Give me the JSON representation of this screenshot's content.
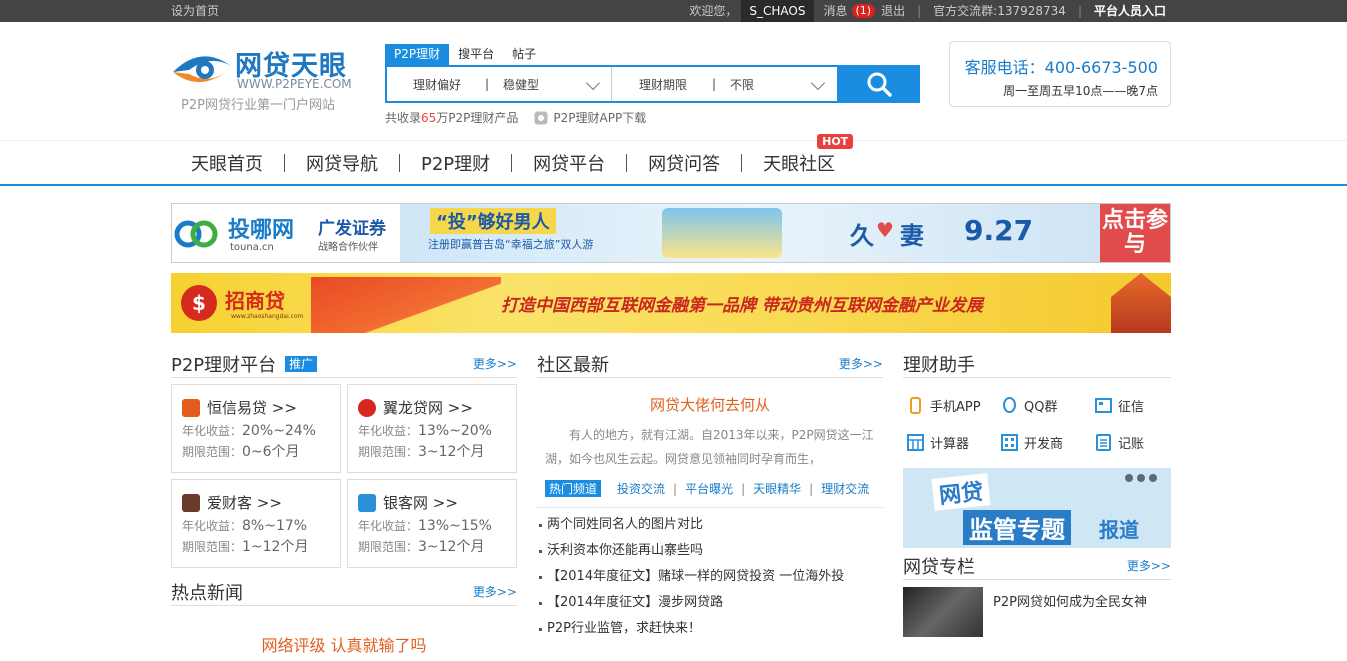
{
  "topbar": {
    "set_home": "设为首页",
    "welcome": "欢迎您，",
    "username": "S_CHAOS",
    "messages": "消息",
    "msg_count": "(1)",
    "logout": "退出",
    "qq_group": "官方交流群:137928734",
    "platform_entry": "平台人员入口"
  },
  "logo": {
    "name": "网贷天眼",
    "url": "WWW.P2PEYE.COM",
    "slogan": "P2P网贷行业第一门户网站"
  },
  "search": {
    "tabs": [
      "P2P理财",
      "搜平台",
      "帖子"
    ],
    "pref_label": "理财偏好",
    "pref_value": "稳健型",
    "term_label": "理财期限",
    "term_value": "不限",
    "sub_prefix": "共收录",
    "sub_count": "65",
    "sub_suffix": "万P2P理财产品",
    "app_label": "P2P理财APP下载"
  },
  "hotline": {
    "phone": "客服电话：400-6673-500",
    "hours": "周一至周五早10点——晚7点"
  },
  "nav": {
    "items": [
      "天眼首页",
      "网贷导航",
      "P2P理财",
      "网贷平台",
      "网贷问答",
      "天眼社区"
    ],
    "hot": "HOT"
  },
  "banner1": {
    "brand": "投哪网",
    "brand_url": "touna.cn",
    "partner": "广发证券",
    "partner_sub": "战略合作伙伴",
    "headline": "“投”够好男人",
    "subline": "注册即赢普吉岛“幸福之旅”双人游",
    "jiu": "久",
    "qi": "妻",
    "date": "9.27",
    "cta": "点击参与"
  },
  "banner2": {
    "brand": "招商贷",
    "brand_url": "www.zhaoshangdai.com",
    "slogan": "打造中国西部互联网金融第一品牌  带动贵州互联网金融产业发展"
  },
  "p2p_platforms": {
    "title": "P2P理财平台",
    "tag": "推广",
    "more": "更多>>",
    "rate_label": "年化收益：",
    "term_label": "期限范围：",
    "items": [
      {
        "name": "恒信易贷 >>",
        "rate": "20%~24%",
        "term": "0~6个月",
        "color": "#e55a1e"
      },
      {
        "name": "翼龙贷网 >>",
        "rate": "13%~20%",
        "term": "3~12个月",
        "color": "#d6261e"
      },
      {
        "name": "爱财客 >>",
        "rate": "8%~17%",
        "term": "1~12个月",
        "color": "#6a3b2a"
      },
      {
        "name": "银客网 >>",
        "rate": "13%~15%",
        "term": "3~12个月",
        "color": "#2a90d8"
      }
    ]
  },
  "hot_news": {
    "title": "热点新闻",
    "more": "更多>>",
    "headline": "网络评级 认真就输了吗"
  },
  "community": {
    "title": "社区最新",
    "more": "更多>>",
    "featured_title": "网贷大佬何去何从",
    "featured_desc": "有人的地方，就有江湖。自2013年以来，P2P网贷这一江湖，如今也风生云起。网贷意见领袖同时孕育而生，",
    "channels": [
      "热门频道",
      "投资交流",
      "平台曝光",
      "天眼精华",
      "理财交流"
    ],
    "posts": [
      "两个同姓同名人的图片对比",
      "沃利资本你还能再山寨些吗",
      "【2014年度征文】赌球一样的网贷投资 一位海外投",
      "【2014年度征文】漫步网贷路",
      "P2P行业监管，求赶快来！"
    ]
  },
  "helper": {
    "title": "理财助手",
    "items": [
      {
        "label": "手机APP",
        "icon": "phone-icon",
        "color": "#f39b1e"
      },
      {
        "label": "QQ群",
        "icon": "qq-icon",
        "color": "#2a90d8"
      },
      {
        "label": "征信",
        "icon": "credit-icon",
        "color": "#2a90d8"
      },
      {
        "label": "计算器",
        "icon": "calculator-icon",
        "color": "#2a90d8"
      },
      {
        "label": "开发商",
        "icon": "developer-icon",
        "color": "#2a90d8"
      },
      {
        "label": "记账",
        "icon": "ledger-icon",
        "color": "#2a90d8"
      }
    ],
    "special_1": "网贷",
    "special_2": "监管专题",
    "special_3": "报道"
  },
  "column": {
    "title": "网贷专栏",
    "more": "更多>>",
    "item": "P2P网贷如何成为全民女神"
  }
}
